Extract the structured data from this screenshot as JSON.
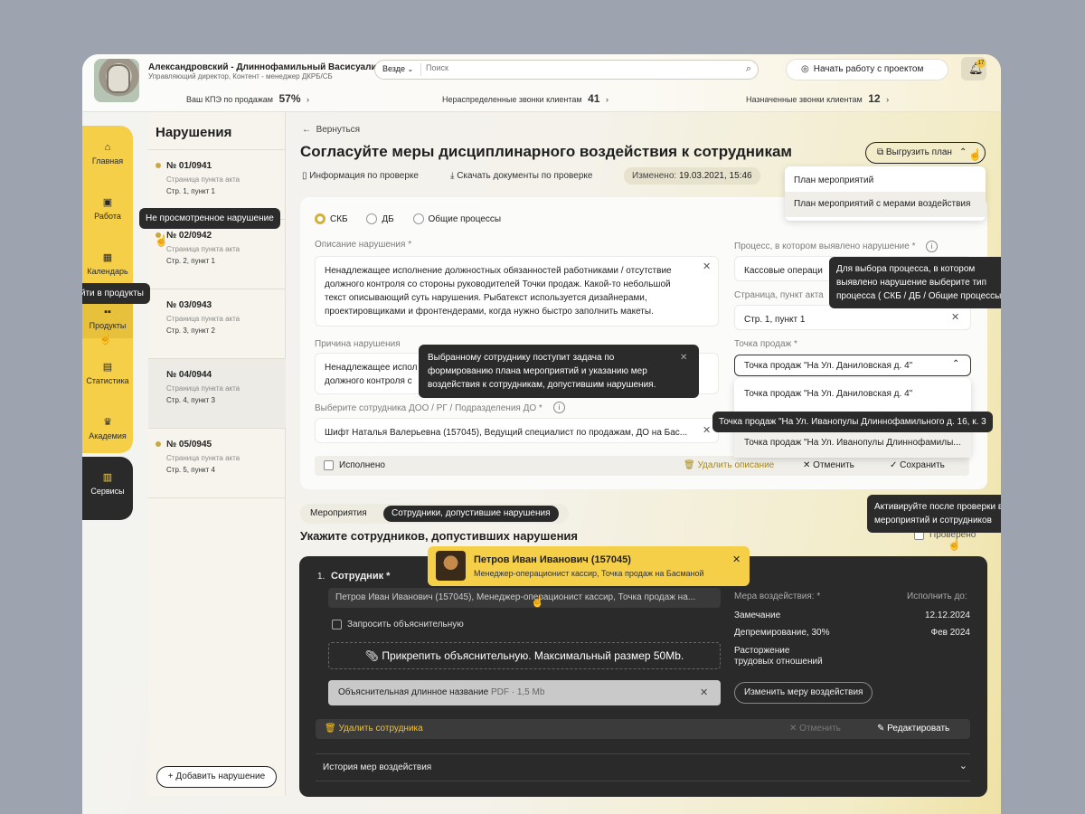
{
  "header": {
    "user_name": "Александровский - Длиннофамильный Васисуалий",
    "user_role": "Управляющий директор, Контент - менеджер ДКРБ/СБ",
    "kpi_label": "Ваш КПЭ по продажам",
    "kpi_value": "57%",
    "unassigned_label": "Нераспределенные звонки клиентам",
    "unassigned_value": "41",
    "assigned_label": "Назначенные звонки клиентам",
    "assigned_value": "12",
    "search_scope": "Везде",
    "search_placeholder": "Поиск",
    "start_btn": "Начать работу с проектом",
    "notif_count": "17"
  },
  "nav": [
    {
      "label": "Главная",
      "icon": "bank-icon"
    },
    {
      "label": "Работа",
      "icon": "briefcase-icon"
    },
    {
      "label": "Календарь",
      "icon": "calendar-icon"
    },
    {
      "label": "Продукты",
      "icon": "grid-icon"
    },
    {
      "label": "Статистика",
      "icon": "chart-icon"
    },
    {
      "label": "Академия",
      "icon": "trophy-icon"
    },
    {
      "label": "Сервисы",
      "icon": "services-icon"
    }
  ],
  "list": {
    "title": "Нарушения",
    "add_btn": "Добавить нарушение",
    "items": [
      {
        "num": "№ 01/0941",
        "sub": "Страница пункта акта",
        "pos": "Стр. 1, пункт 1"
      },
      {
        "num": "№ 02/0942",
        "sub": "Страница пункта акта",
        "pos": "Стр. 2, пункт 1"
      },
      {
        "num": "№ 03/0943",
        "sub": "Страница пункта акта",
        "pos": "Стр. 3, пункт 2"
      },
      {
        "num": "№ 04/0944",
        "sub": "Страница пункта акта",
        "pos": "Стр. 4, пункт 3"
      },
      {
        "num": "№ 05/0945",
        "sub": "Страница пункта акта",
        "pos": "Стр. 5, пункт 4"
      }
    ]
  },
  "main": {
    "back": "Вернуться",
    "title": "Согласуйте меры дисциплинарного воздействия к сотрудникам",
    "export_btn": "Выгрузить план",
    "info_link": "Информация по проверке",
    "download_link": "Скачать документы по проверке",
    "changed_label": "Изменено:",
    "changed_value": "19.03.2021, 15:46",
    "export_menu": [
      "План мероприятий",
      "План мероприятий с мерами воздействия"
    ]
  },
  "form": {
    "radios": [
      "СКБ",
      "ДБ",
      "Общие процессы"
    ],
    "desc_label": "Описание нарушения *",
    "desc_value": "Ненадлежащее исполнение должностных обязанностей работниками / отсутствие должного контроля со стороны руководителей Точки продаж. Какой-то небольшой текст описывающий суть нарушения. Рыбатекст используется дизайнерами, проектировщиками и фронтендерами, когда нужно быстро заполнить макеты.",
    "reason_label": "Причина нарушения",
    "reason_value_1": "Ненадлежащее испол",
    "reason_value_2": "должного контроля с",
    "employee_label": "Выберите сотрудника ДОО / РГ / Подразделения ДО *",
    "employee_value": "Шифт Наталья Валерьевна (157045), Ведущий специалист по продажам, ДО на Бас...",
    "process_label": "Процесс, в котором выявлено нарушение *",
    "process_value": "Кассовые операци",
    "page_label": "Страница, пункт акта",
    "page_value": "Стр. 1, пункт 1",
    "point_label": "Точка продаж *",
    "point_value": "Точка продаж \"На Ул. Даниловская д. 4\"",
    "point_options": [
      "Точка продаж \"На Ул. Даниловская д. 4\"",
      "Точка продаж \"На Ул. Иванопулы Длиннофамилы..."
    ],
    "done_label": "Исполнено",
    "delete_desc": "Удалить описание",
    "cancel": "Отменить",
    "save": "Сохранить"
  },
  "tooltips": {
    "unviewed": "Не просмотренное нарушение",
    "products": "Перейти в продукты",
    "process_help": "Для выбора процесса, в котором выявлено нарушение выберите тип процесса ( СКБ / ДБ / Общие процессы).",
    "employee_help": "Выбранному сотруднику поступит задача по формированию плана мероприятий и указанию мер воздействия к сотрудникам, допустившим нарушения.",
    "point_full": "Точка продаж \"На Ул. Иванопулы Длиннофамильного д. 16, к. 3",
    "verified_help": "Активируйте после проверки всех мероприятий и сотрудников"
  },
  "lower": {
    "tabs": [
      "Мероприятия",
      "Сотрудники, допустившие нарушения"
    ],
    "heading": "Укажите сотрудников, допустивших нарушения",
    "verified": "Проверено"
  },
  "emp_card": {
    "index": "1.",
    "label": "Сотрудник *",
    "value": "Петров Иван Иванович (157045), Менеджер-операционист кассир, Точка продаж на...",
    "request": "Запросить объяснительную",
    "attach": "Прикрепить объяснительную. Максимальный размер 50Mb.",
    "file_name": "Объяснительная длинное название",
    "file_meta": "PDF · 1,5 Mb",
    "measure_label": "Мера воздействия: *",
    "due_label": "Исполнить до:",
    "measures": [
      {
        "name": "Замечание",
        "date": "12.12.2024"
      },
      {
        "name": "Депремирование, 30%",
        "date": "Фев 2024"
      },
      {
        "name": "Расторжение трудовых отношений",
        "date": ""
      }
    ],
    "change_btn": "Изменить меру воздействия",
    "delete": "Удалить сотрудника",
    "cancel": "Отменить",
    "edit": "Редактировать",
    "history": "История мер воздействия"
  },
  "popup": {
    "name": "Петров Иван Иванович (157045)",
    "role": "Менеджер-операционист кассир, Точка продаж на Басманой"
  }
}
